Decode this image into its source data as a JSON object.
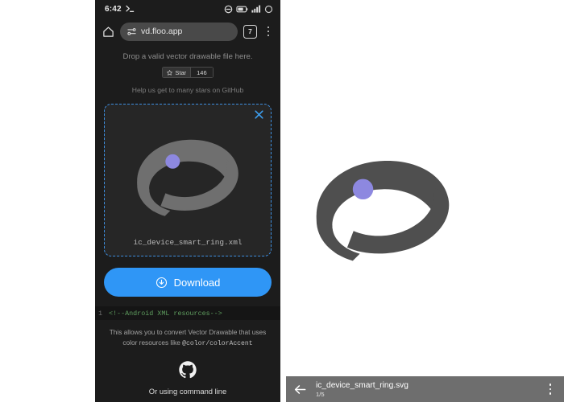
{
  "phone": {
    "status_bar": {
      "time": "6:42",
      "terminal_icon": "terminal-prompt-icon",
      "icons": [
        "do-not-disturb-icon",
        "battery-icon",
        "signal-bars-icon",
        "circle-icon"
      ]
    },
    "browser": {
      "home_icon": "home-icon",
      "page_info_icon": "page-info-icon",
      "url": "vd.floo.app",
      "tab_count": "7",
      "overflow_icon": "overflow-menu-icon"
    },
    "page": {
      "drop_hint": "Drop a valid vector drawable file here.",
      "star_label": "Star",
      "star_count": "146",
      "github_help": "Help us get to many stars on GitHub",
      "dropzone": {
        "close_icon": "close-icon",
        "preview_icon": "smart-ring-icon",
        "filename": "ic_device_smart_ring.xml"
      },
      "download_label": "Download",
      "download_icon": "download-circle-icon",
      "code": {
        "line_number": "1",
        "line_text": "<!--Android XML resources-->"
      },
      "convert_note_prefix": "This allows you to convert Vector Drawable that uses color resources like ",
      "convert_note_code": "@color/colorAccent",
      "github_icon": "github-icon",
      "command_line_text": "Or using command line"
    }
  },
  "artwork": {
    "icon": "smart-ring-icon",
    "band_color": "#4f4f4f",
    "sensor_color": "#8d88e0"
  },
  "viewer_bar": {
    "back_icon": "back-arrow-icon",
    "filename": "ic_device_smart_ring.svg",
    "counter": "1/5",
    "menu_icon": "overflow-menu-icon"
  },
  "colors": {
    "accent_blue": "#2f96f6",
    "dropzone_border": "#3d8ee0",
    "phone_bg": "#1c1c1c",
    "viewer_bar_bg": "#6e6e6e",
    "code_green": "#5f9e5f"
  }
}
